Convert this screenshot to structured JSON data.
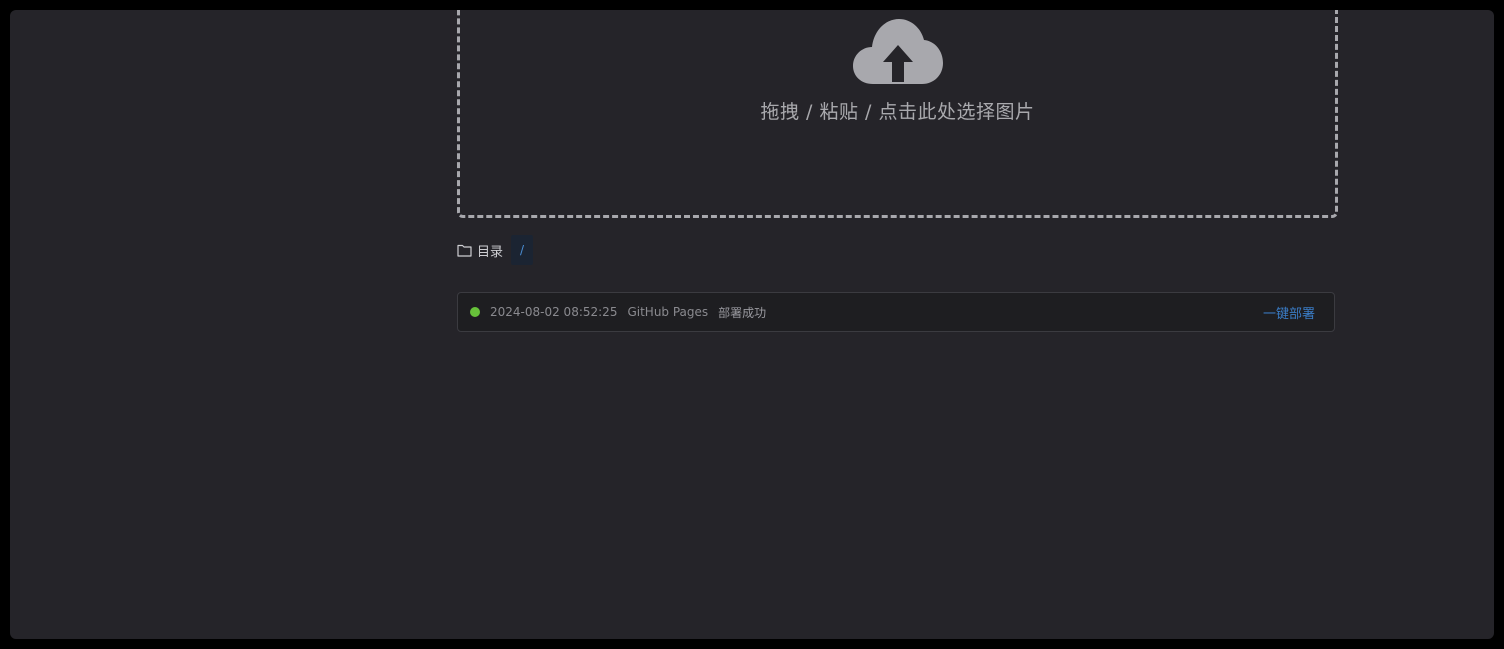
{
  "upload": {
    "icon": "cloud-upload-icon",
    "hint": "拖拽 / 粘贴 / 点击此处选择图片"
  },
  "directory": {
    "icon": "folder-icon",
    "label": "目录",
    "path": "/"
  },
  "deploy": {
    "status_color": "#67c23a",
    "time": "2024-08-02 08:52:25",
    "target": "GitHub Pages",
    "status": "部署成功",
    "button_label": "一键部署"
  },
  "colors": {
    "background": "#252429",
    "accent": "#3a7cc6",
    "success": "#67c23a"
  }
}
